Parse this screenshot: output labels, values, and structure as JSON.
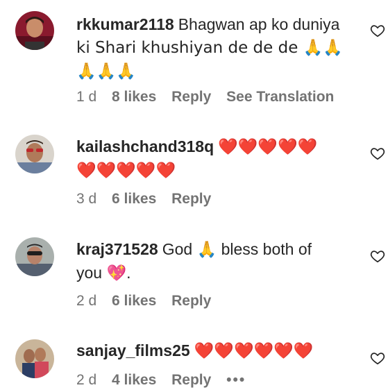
{
  "comments": [
    {
      "username": "rkkumar2118",
      "line1": "Bhagwan ap ko duniya",
      "line2": "ki Shari khushiyan de de de 🙏🙏",
      "line3": "🙏🙏🙏",
      "time": "1 d",
      "likes": "8 likes",
      "reply": "Reply",
      "translation": "See Translation"
    },
    {
      "username": "kailashchand318q",
      "line1": "❤️❤️❤️❤️❤️",
      "line2": "❤️❤️❤️❤️❤️",
      "time": "3 d",
      "likes": "6 likes",
      "reply": "Reply"
    },
    {
      "username": "kraj371528",
      "line1": "God 🙏 bless both of",
      "line2": "you 💖.",
      "time": "2 d",
      "likes": "6 likes",
      "reply": "Reply"
    },
    {
      "username": "sanjay_films25",
      "line1": "❤️❤️❤️❤️❤️❤️",
      "time": "2 d",
      "likes": "4 likes",
      "reply": "Reply",
      "more": "•••"
    }
  ],
  "icons": {
    "like": "heart-outline-icon",
    "more": "more-options-icon"
  },
  "colors": {
    "text": "#262626",
    "secondary": "#737373",
    "background": "#ffffff"
  }
}
